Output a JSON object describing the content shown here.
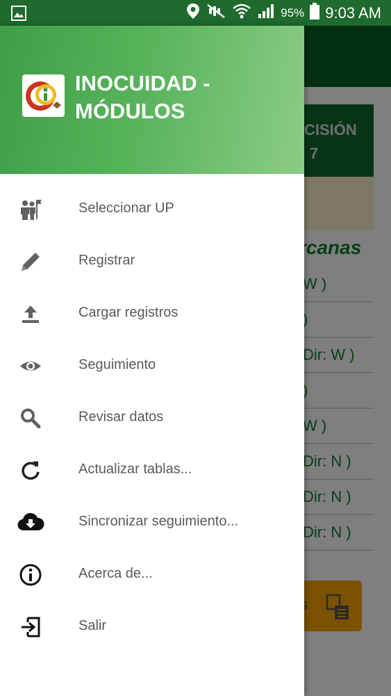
{
  "status_bar": {
    "battery_percent": "95%",
    "time": "9:03 AM",
    "icons": [
      "gallery-icon",
      "location-icon",
      "mute-icon",
      "wifi-icon",
      "signal-icon",
      "battery-icon"
    ]
  },
  "background": {
    "card_line1": "CISIÓN",
    "card_line2": "7",
    "heading": "rcanas",
    "rows": [
      "W )",
      ")",
      "Dir: W )",
      ")",
      "W )",
      "Dir: N )",
      "Dir: N )",
      "Dir: N )"
    ],
    "button_fragment": "s"
  },
  "drawer": {
    "title_line1": "INOCUIDAD -",
    "title_line2": "MÓDULOS",
    "items": [
      {
        "label": "Seleccionar UP",
        "icon": "people-flag-icon"
      },
      {
        "label": "Registrar",
        "icon": "pencil-icon"
      },
      {
        "label": "Cargar registros",
        "icon": "upload-icon"
      },
      {
        "label": "Seguimiento",
        "icon": "eye-icon"
      },
      {
        "label": "Revisar datos",
        "icon": "search-icon"
      },
      {
        "label": "Actualizar tablas...",
        "icon": "refresh-icon"
      },
      {
        "label": "Sincronizar seguimiento...",
        "icon": "cloud-download-icon"
      },
      {
        "label": "Acerca de...",
        "icon": "info-icon"
      },
      {
        "label": "Salir",
        "icon": "exit-icon"
      }
    ]
  },
  "colors": {
    "status_bar": "#1f6a2d",
    "toolbar": "#0b5f24",
    "header_start": "#3f9e46",
    "header_end": "#8ccc86",
    "accent_button": "#f5a400"
  }
}
